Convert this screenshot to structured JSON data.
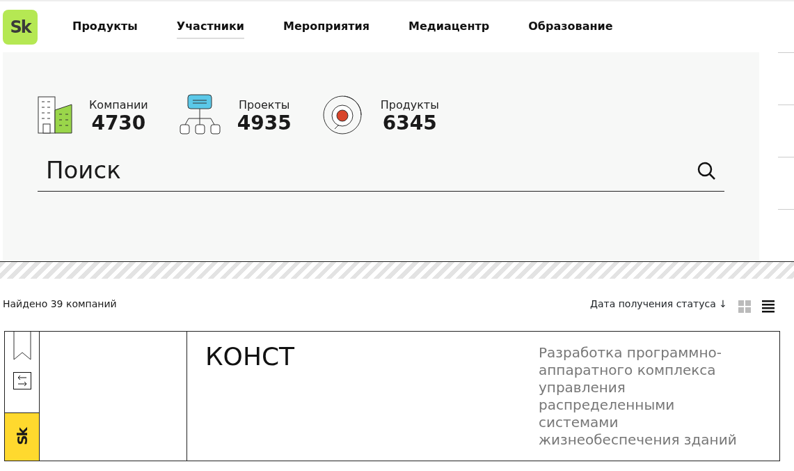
{
  "logo": {
    "text": "Sk"
  },
  "nav": [
    {
      "label": "Продукты",
      "selected": false
    },
    {
      "label": "Участники",
      "selected": true
    },
    {
      "label": "Мероприятия",
      "selected": false
    },
    {
      "label": "Медиацентр",
      "selected": false
    },
    {
      "label": "Образование",
      "selected": false
    }
  ],
  "stats": [
    {
      "kind": "buildings",
      "label": "Компании",
      "value": "4730"
    },
    {
      "kind": "hierarchy",
      "label": "Проекты",
      "value": "4935"
    },
    {
      "kind": "target",
      "label": "Продукты",
      "value": "6345"
    }
  ],
  "search": {
    "placeholder": "Поиск"
  },
  "results": {
    "count": "Найдено 39 компаний",
    "sort": "Дата получения статуса ↓",
    "view_grid": false,
    "view_list": true
  },
  "cards": [
    {
      "badge": "Sk",
      "title": "КОНСТ",
      "description": "Разработка программно-аппаратного комплекса управления распределенными системами жизнеобеспечения зданий"
    }
  ]
}
